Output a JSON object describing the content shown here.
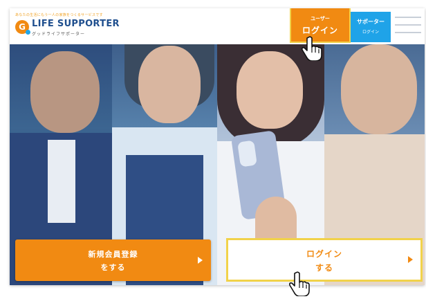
{
  "header": {
    "logo_subtitle": "あなたの生活にもう一人の家族をつくるサービスです",
    "logo_mark": "G",
    "logo_name": "LIFE SUPPORTER",
    "logo_kana": "グッドライフサポーター",
    "user_login": {
      "small": "ユーザー",
      "big": "ログイン"
    },
    "supporter_login": {
      "small": "サポーター",
      "big": "ログイン"
    },
    "menu_icon": "hamburger-icon"
  },
  "cta": {
    "register": {
      "line1": "新規会員登録",
      "line2": "をする"
    },
    "login": {
      "line1": "ログイン",
      "line2": "する"
    }
  },
  "colors": {
    "orange": "#f18a12",
    "blue": "#1fa3e8",
    "highlight": "#f1d24a",
    "logo_blue": "#1f4f8e"
  }
}
